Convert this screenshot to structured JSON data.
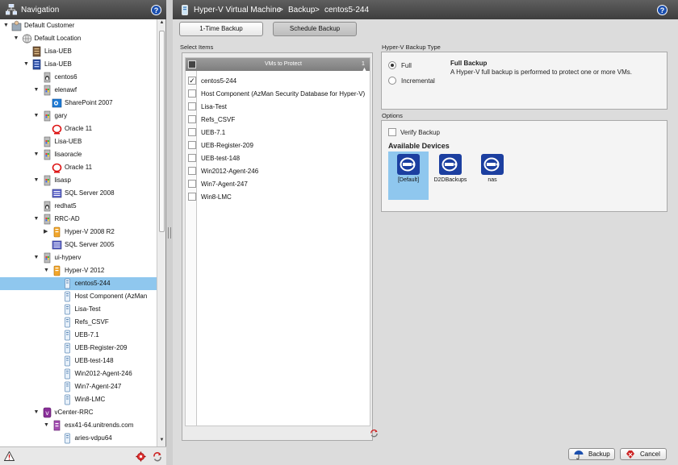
{
  "nav": {
    "title": "Navigation",
    "help": "?",
    "tree": [
      {
        "label": "Default Customer",
        "level": 0,
        "expander": "open",
        "icon": "customer-icon"
      },
      {
        "label": "Default Location",
        "level": 1,
        "expander": "open",
        "icon": "globe-icon"
      },
      {
        "label": "Lisa-UEB",
        "level": 2,
        "expander": "none",
        "icon": "appliance-icon"
      },
      {
        "label": "Lisa-UEB",
        "level": 2,
        "expander": "open",
        "icon": "server-icon"
      },
      {
        "label": "centos6",
        "level": 3,
        "expander": "none",
        "icon": "linux-icon"
      },
      {
        "label": "elenawf",
        "level": 3,
        "expander": "open",
        "icon": "windows-server-icon"
      },
      {
        "label": "SharePoint 2007",
        "level": 4,
        "expander": "none",
        "icon": "sharepoint-icon"
      },
      {
        "label": "gary",
        "level": 3,
        "expander": "open",
        "icon": "windows-server-icon"
      },
      {
        "label": "Oracle 11",
        "level": 4,
        "expander": "none",
        "icon": "oracle-icon"
      },
      {
        "label": "Lisa-UEB",
        "level": 3,
        "expander": "none",
        "icon": "windows-server-icon"
      },
      {
        "label": "lisaoracle",
        "level": 3,
        "expander": "open",
        "icon": "windows-server-icon"
      },
      {
        "label": "Oracle 11",
        "level": 4,
        "expander": "none",
        "icon": "oracle-icon"
      },
      {
        "label": "lisasp",
        "level": 3,
        "expander": "open",
        "icon": "windows-server-icon"
      },
      {
        "label": "SQL Server 2008",
        "level": 4,
        "expander": "none",
        "icon": "sql-server-icon"
      },
      {
        "label": "redhat5",
        "level": 3,
        "expander": "none",
        "icon": "linux-icon"
      },
      {
        "label": "RRC-AD",
        "level": 3,
        "expander": "open",
        "icon": "windows-server-icon"
      },
      {
        "label": "Hyper-V 2008 R2",
        "level": 4,
        "expander": "closed",
        "icon": "hyperv-icon"
      },
      {
        "label": "SQL Server 2005",
        "level": 4,
        "expander": "none",
        "icon": "sql-server-icon"
      },
      {
        "label": "ui-hyperv",
        "level": 3,
        "expander": "open",
        "icon": "windows-server-icon"
      },
      {
        "label": "Hyper-V 2012",
        "level": 4,
        "expander": "open",
        "icon": "hyperv-icon"
      },
      {
        "label": "centos5-244",
        "level": 5,
        "expander": "none",
        "icon": "vm-icon",
        "selected": true
      },
      {
        "label": "Host Component (AzMan",
        "level": 5,
        "expander": "none",
        "icon": "vm-icon"
      },
      {
        "label": "Lisa-Test",
        "level": 5,
        "expander": "none",
        "icon": "vm-icon"
      },
      {
        "label": "Refs_CSVF",
        "level": 5,
        "expander": "none",
        "icon": "vm-icon"
      },
      {
        "label": "UEB-7.1",
        "level": 5,
        "expander": "none",
        "icon": "vm-icon"
      },
      {
        "label": "UEB-Register-209",
        "level": 5,
        "expander": "none",
        "icon": "vm-icon"
      },
      {
        "label": "UEB-test-148",
        "level": 5,
        "expander": "none",
        "icon": "vm-icon"
      },
      {
        "label": "Win2012-Agent-246",
        "level": 5,
        "expander": "none",
        "icon": "vm-icon"
      },
      {
        "label": "Win7-Agent-247",
        "level": 5,
        "expander": "none",
        "icon": "vm-icon"
      },
      {
        "label": "Win8-LMC",
        "level": 5,
        "expander": "none",
        "icon": "vm-icon"
      },
      {
        "label": "vCenter-RRC",
        "level": 3,
        "expander": "open",
        "icon": "vcenter-icon"
      },
      {
        "label": "esx41-64.unitrends.com",
        "level": 4,
        "expander": "open",
        "icon": "esx-host-icon"
      },
      {
        "label": "aries-vdpu64",
        "level": 5,
        "expander": "none",
        "icon": "vm-icon"
      }
    ]
  },
  "main": {
    "breadcrumb": [
      "Hyper-V Virtual Machine",
      ">",
      "Backup",
      ">",
      "centos5-244"
    ],
    "help": "?",
    "tabs": [
      {
        "label": "1-Time Backup",
        "active": true
      },
      {
        "label": "Schedule Backup",
        "active": false
      }
    ],
    "select_items": {
      "label": "Select Items",
      "column_header": "VMs to Protect",
      "sort_indicator": "1 ▲",
      "rows": [
        {
          "name": "centos5-244",
          "checked": true
        },
        {
          "name": "Host Component (AzMan Security Database for Hyper-V)",
          "checked": false
        },
        {
          "name": "Lisa-Test",
          "checked": false
        },
        {
          "name": "Refs_CSVF",
          "checked": false
        },
        {
          "name": "UEB-7.1",
          "checked": false
        },
        {
          "name": "UEB-Register-209",
          "checked": false
        },
        {
          "name": "UEB-test-148",
          "checked": false
        },
        {
          "name": "Win2012-Agent-246",
          "checked": false
        },
        {
          "name": "Win7-Agent-247",
          "checked": false
        },
        {
          "name": "Win8-LMC",
          "checked": false
        }
      ]
    },
    "backup_type": {
      "label": "Hyper-V Backup Type",
      "options": [
        {
          "label": "Full",
          "selected": true
        },
        {
          "label": "Incremental",
          "selected": false
        }
      ],
      "description_title": "Full Backup",
      "description": "A Hyper-V full backup is performed to protect one or more VMs."
    },
    "options": {
      "label": "Options",
      "verify_backup": "Verify Backup",
      "verify_checked": false,
      "available_devices_label": "Available Devices",
      "devices": [
        {
          "label": "[Default]",
          "selected": true
        },
        {
          "label": "D2DBackups",
          "selected": false
        },
        {
          "label": "nas",
          "selected": false
        }
      ]
    },
    "actions": {
      "backup": "Backup",
      "cancel": "Cancel"
    }
  },
  "colors": {
    "header": "#4a4a4a",
    "selection": "#8fc7ee",
    "device_blue": "#1c3fa0",
    "help_blue": "#1b4fae"
  }
}
